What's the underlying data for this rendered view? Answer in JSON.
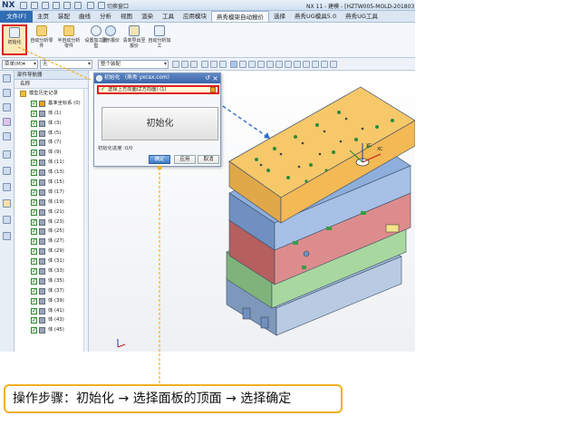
{
  "app": {
    "logo": "NX",
    "switch_window": "切换窗口",
    "window_title": "NX 11 - 建模 - [HZTW005-MOLD-2018031"
  },
  "menu": {
    "file": "文件(F)",
    "tabs": [
      "主页",
      "装配",
      "曲线",
      "分析",
      "视图",
      "渲染",
      "工具",
      "应用模块",
      "燕秀模架自动报价",
      "选择",
      "燕秀UG模具5.0",
      "燕秀UG工具"
    ],
    "active_index": 8
  },
  "ribbon": {
    "buttons": [
      "初始化",
      "自动分析零件",
      "半自动分析零件",
      "设置加工类型",
      "显示报价",
      "清单导出至报价",
      "自动分析加工"
    ]
  },
  "toolbar": {
    "filter": "菜单(M)▾",
    "filter_value": "无",
    "assembly": "整个装配"
  },
  "navigator": {
    "title": "部件导航器",
    "column": "名称",
    "root": "模型历史记录",
    "items": [
      "基准坐标系 (0)",
      "体 (1)",
      "体 (3)",
      "体 (5)",
      "体 (7)",
      "体 (9)",
      "体 (11)",
      "体 (13)",
      "体 (15)",
      "体 (17)",
      "体 (19)",
      "体 (21)",
      "体 (23)",
      "体 (25)",
      "体 (27)",
      "体 (29)",
      "体 (31)",
      "体 (33)",
      "体 (35)",
      "体 (37)",
      "体 (39)",
      "体 (41)",
      "体 (43)",
      "体 (45)"
    ]
  },
  "dialog": {
    "title": "初始化 （燕秀 yxcax.com）",
    "selection": "选择上方向面(Z方向面) (1)",
    "big_button": "初始化",
    "progress": "初始化进度 :0/0",
    "ok": "确定",
    "apply": "应用",
    "cancel": "取消"
  },
  "axis_labels": {
    "yc": "YC",
    "xc": "XC",
    "zc": "ZC"
  },
  "annotation": {
    "text": "操作步骤：初始化  →  选择面板的顶面 → 选择确定"
  },
  "colors": {
    "accent": "#2f6db5",
    "highlight": "#e0201c",
    "plate_top": "#f6c86a",
    "plate_blue": "#7fa3d4",
    "plate_red": "#cc6a6a",
    "plate_green": "#8ec08a",
    "callout": "#f0b020"
  }
}
